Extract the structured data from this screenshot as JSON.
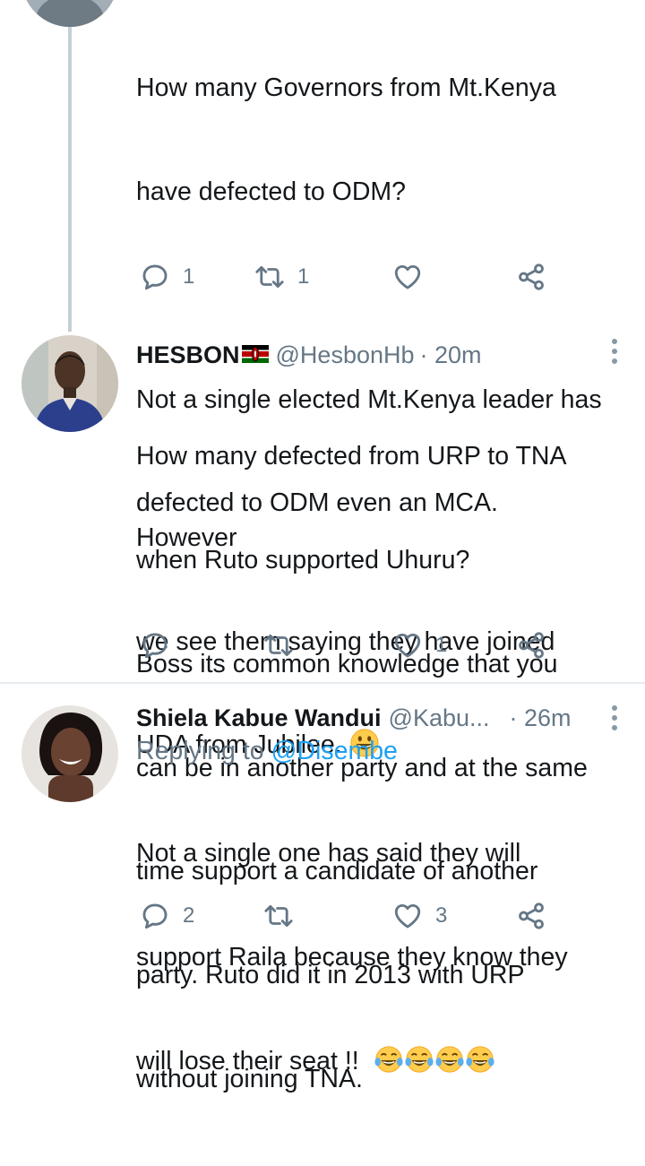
{
  "tweets": [
    {
      "text_lines": [
        "How many Governors from Mt.Kenya",
        "have defected to ODM?",
        "",
        "Not a single elected Mt.Kenya leader has",
        "defected to ODM even an MCA. However",
        "we see them saying they have joined",
        "UDA from Jubilee."
      ],
      "reply_count": "1",
      "retweet_count": "1",
      "like_count": ""
    },
    {
      "name": "HESBON",
      "handle": "@HesbonHb",
      "time": "· 20m",
      "text_lines": [
        "How many defected from URP to TNA",
        "when Ruto supported Uhuru?",
        "Boss its common knowledge that you",
        "can be in another party and at the same",
        "time support a candidate of another",
        "party. Ruto did it in 2013 with URP",
        "without joining TNA."
      ],
      "reply_count": "",
      "retweet_count": "",
      "like_count": "1"
    },
    {
      "name": "Shiela Kabue Wandui",
      "handle": "@Kabu...",
      "time": "· 26m",
      "replying_label": "Replying to",
      "replying_mention": "@Disembe",
      "text_lines": [
        "Not a single one has said they will",
        "support Raila because they know they",
        "will lose their seat !!"
      ],
      "reply_count": "2",
      "retweet_count": "",
      "like_count": "3"
    }
  ],
  "icons": {
    "reply": "reply-icon",
    "retweet": "retweet-icon",
    "like": "heart-icon",
    "share": "share-icon",
    "more": "more-vertical-icon",
    "grin": "grinning-emoji-icon",
    "laugh": "tears-of-joy-emoji-icon",
    "flag": "kenya-flag-icon"
  },
  "colors": {
    "text": "#14171a",
    "secondary": "#657786",
    "link": "#1da1f2",
    "thread_line": "#c4cfd6",
    "divider": "#e6ecf0"
  }
}
